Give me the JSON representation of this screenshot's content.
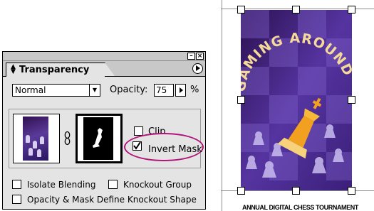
{
  "palette": {
    "tab_title": "Transparency",
    "blend_mode": "Normal",
    "opacity_label": "Opacity:",
    "opacity_value": "75",
    "percent_sign": "%",
    "clip_label": "Clip",
    "clip_checked": false,
    "invert_mask_label": "Invert Mask",
    "invert_mask_checked": true,
    "isolate_blending_label": "Isolate Blending",
    "isolate_blending_checked": false,
    "knockout_group_label": "Knockout Group",
    "knockout_group_checked": false,
    "opacity_mask_knockout_label": "Opacity & Mask Define Knockout Shape",
    "opacity_mask_knockout_checked": false,
    "highlight_color": "#b01478"
  },
  "poster": {
    "headline": "GAMING AROUND",
    "caption": "ANNUAL DIGITAL CHESS TOURNAMENT",
    "background_color": "#3a1c6b",
    "headline_color": "#f4d99a",
    "king_color": "#f2a020"
  }
}
